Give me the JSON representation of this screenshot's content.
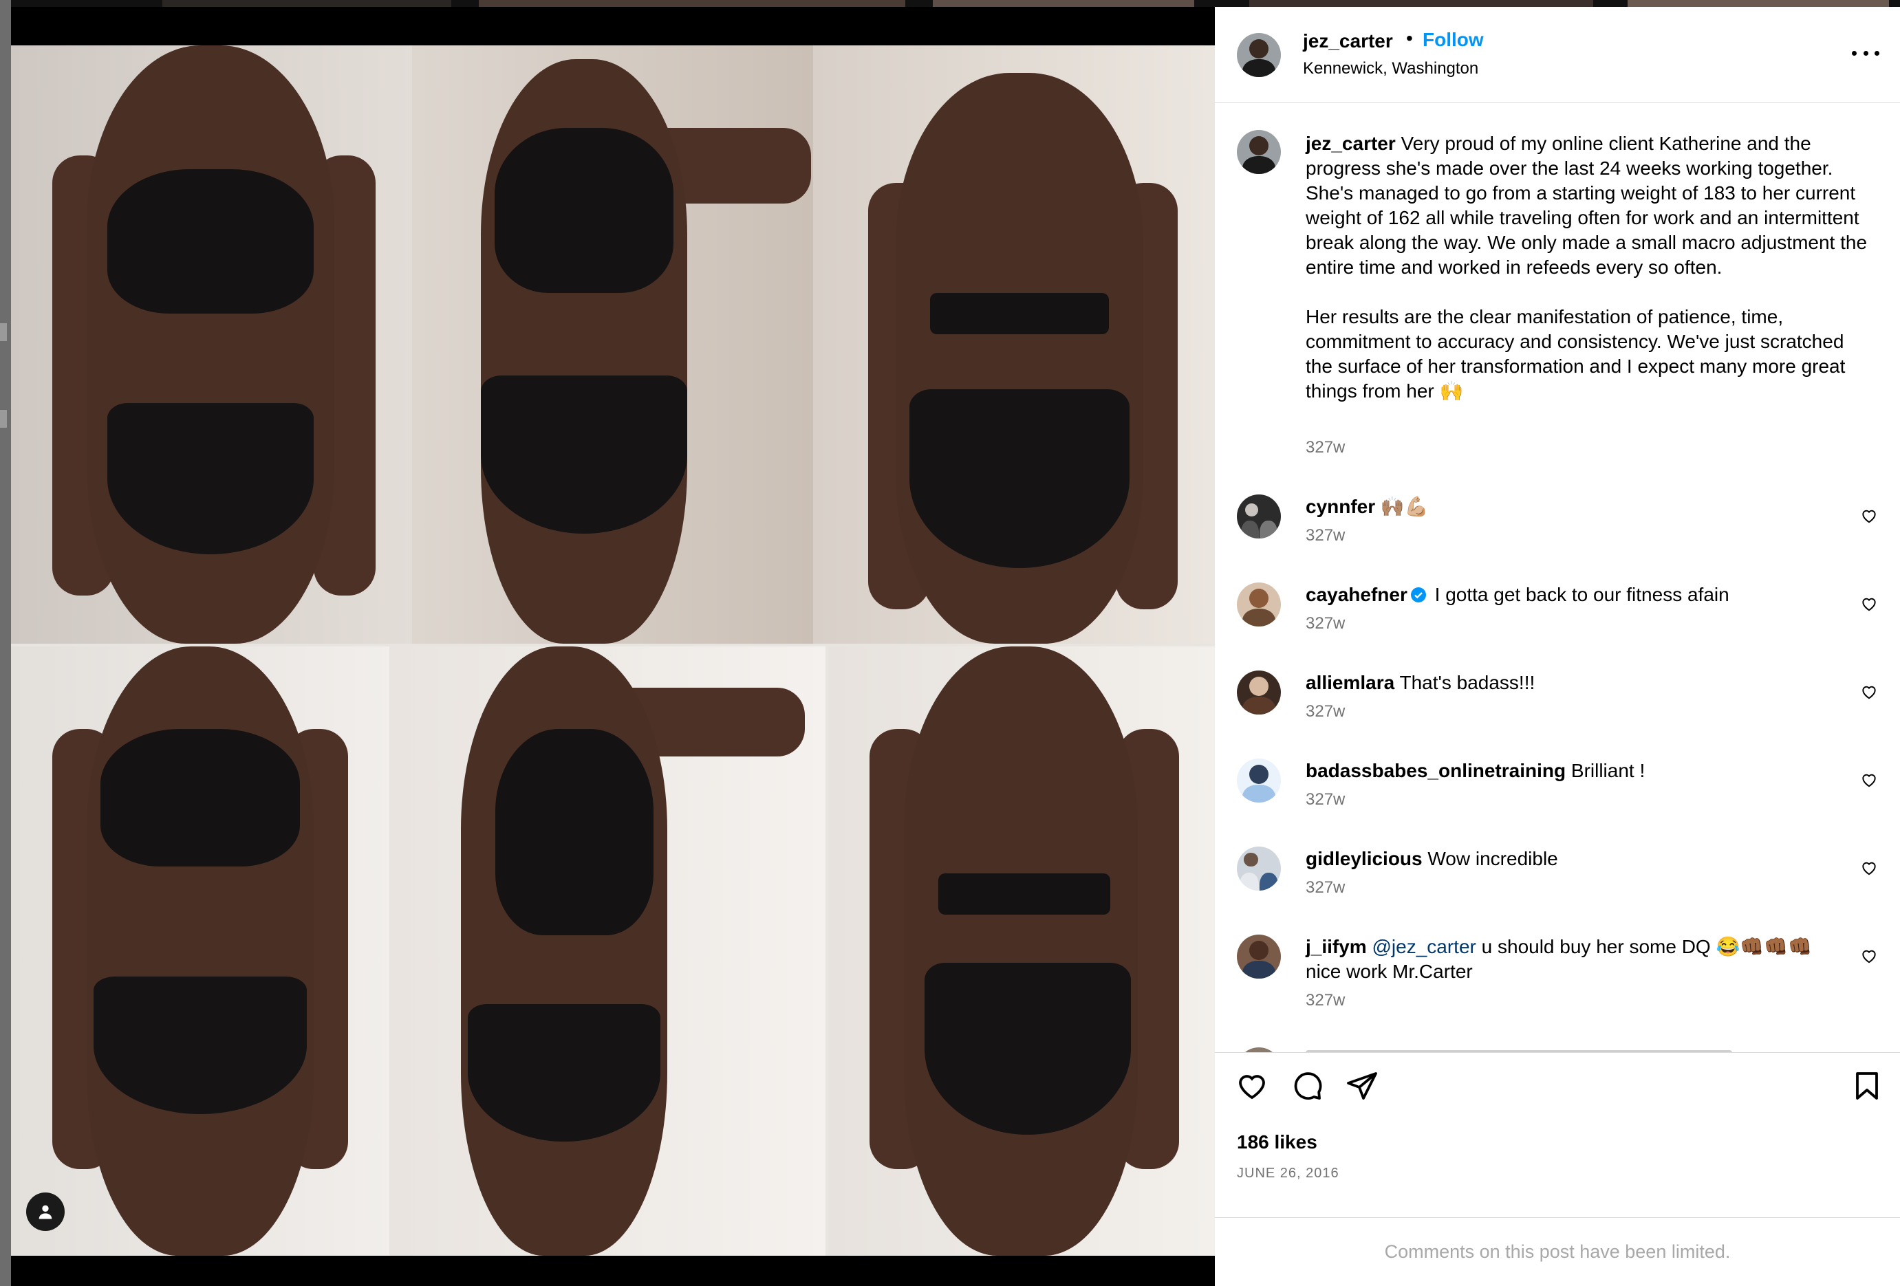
{
  "post": {
    "author": "jez_carter",
    "separator": "•",
    "follow_label": "Follow",
    "location": "Kennewick, Washington",
    "caption_author": "jez_carter",
    "caption_text": " Very proud of my online client Katherine and the progress she's made over the last 24 weeks working together. She's managed to go from a starting weight of 183 to her current weight of 162 all while traveling often for work and an intermittent break along the way. We only made a small macro adjustment the entire time and worked in refeeds every so often.\n\nHer results are the clear manifestation of patience, time, commitment to accuracy and consistency. We've just scratched the surface of her transformation and I expect many more great things from her 🙌",
    "caption_time": "327w",
    "likes": "186 likes",
    "date": "JUNE 26, 2016",
    "comments_limited": "Comments on this post have been limited."
  },
  "comments": [
    {
      "user": "cynnfer",
      "text": " 🙌🏽💪🏼",
      "time": "327w",
      "verified": false,
      "mention": "",
      "text_after": ""
    },
    {
      "user": "cayahefner",
      "text": " I gotta get back to our fitness afain",
      "time": "327w",
      "verified": true,
      "mention": "",
      "text_after": ""
    },
    {
      "user": "alliemlara",
      "text": " That's badass!!!",
      "time": "327w",
      "verified": false,
      "mention": "",
      "text_after": ""
    },
    {
      "user": "badassbabes_onlinetraining",
      "text": " Brilliant !",
      "time": "327w",
      "verified": false,
      "mention": "",
      "text_after": ""
    },
    {
      "user": "gidleylicious",
      "text": " Wow incredible",
      "time": "327w",
      "verified": false,
      "mention": "",
      "text_after": ""
    },
    {
      "user": "j_iifym",
      "text": " ",
      "time": "327w",
      "verified": false,
      "mention": "@jez_carter",
      "text_after": " u should buy her some DQ 😂👊🏾👊🏾👊🏾 nice work Mr.Carter"
    }
  ],
  "icons": {
    "more": "more-options-icon",
    "like": "heart-icon",
    "comment": "comment-icon",
    "share": "share-icon",
    "save": "bookmark-icon",
    "tag": "user-tag-icon"
  },
  "colors": {
    "link": "#0095f6",
    "mention": "#00376b",
    "muted": "#737373",
    "border": "#dbdbdb",
    "verified": "#0095f6"
  }
}
